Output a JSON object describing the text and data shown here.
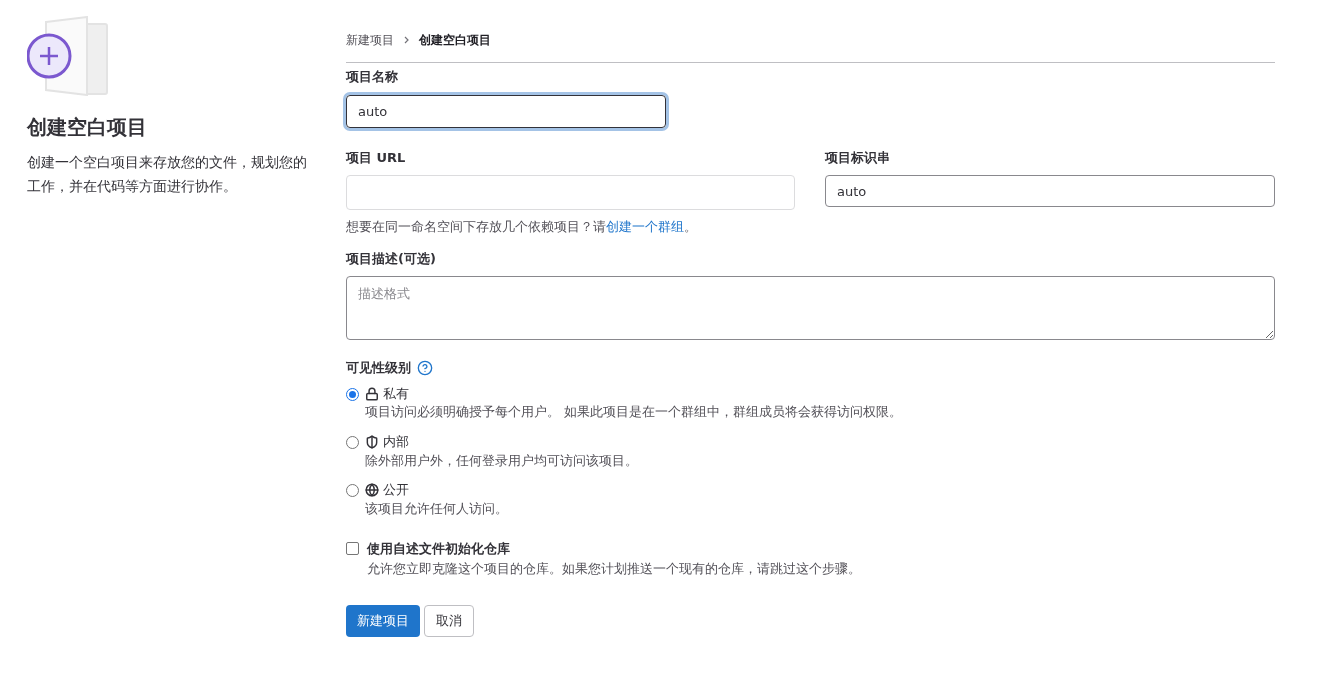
{
  "sidebar": {
    "title": "创建空白项目",
    "description": "创建一个空白项目来存放您的文件，规划您的工作，并在代码等方面进行协作。"
  },
  "breadcrumb": [
    {
      "label": "新建项目",
      "selected": false
    },
    {
      "label": "创建空白项目",
      "selected": true
    }
  ],
  "project_name": {
    "label": "项目名称",
    "value": "auto"
  },
  "project_url": {
    "label": "项目 URL"
  },
  "project_slug": {
    "label": "项目标识串",
    "value": "auto"
  },
  "group_hint": {
    "before": "想要在同一命名空间下存放几个依赖项目？请",
    "link": "创建一个群组",
    "after": "。"
  },
  "description": {
    "label": "项目描述(可选)",
    "placeholder": "描述格式"
  },
  "visibility": {
    "label": "可见性级别",
    "options": [
      {
        "kind": "lock",
        "label": "私有",
        "description": "项目访问必须明确授予每个用户。 如果此项目是在一个群组中，群组成员将会获得访问权限。",
        "selected": true
      },
      {
        "kind": "shield",
        "label": "内部",
        "description": "除外部用户外，任何登录用户均可访问该项目。",
        "selected": false
      },
      {
        "kind": "globe",
        "label": "公开",
        "description": "该项目允许任何人访问。",
        "selected": false
      }
    ]
  },
  "readme": {
    "label": "使用自述文件初始化仓库",
    "description": "允许您立即克隆这个项目的仓库。如果您计划推送一个现有的仓库，请跳过这个步骤。",
    "checked": false
  },
  "buttons": {
    "primary": "新建项目",
    "secondary": "取消"
  }
}
